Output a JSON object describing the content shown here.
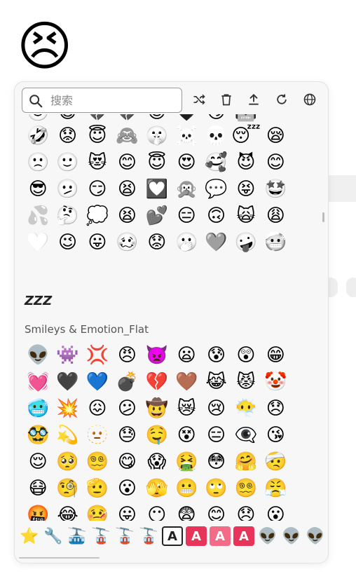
{
  "hero_emoji": "😣",
  "search": {
    "placeholder": "搜索"
  },
  "toolbar": {
    "icons": [
      "shuffle-icon",
      "trash-icon",
      "upload-icon",
      "refresh-icon",
      "globe-icon"
    ]
  },
  "outline_top_partial": [
    "🙂",
    "😺",
    "💔",
    "💔",
    "😊",
    "🖤",
    "😏",
    "🤖",
    ""
  ],
  "outline_rows": [
    [
      "🤣",
      "😟",
      "😇",
      "🙈",
      "🤫",
      "☠️",
      "💀",
      "😴",
      "😪"
    ],
    [
      "🙁",
      "🙂",
      "😻",
      "😊",
      "😇",
      "😍",
      "🥰",
      "😈",
      "😊"
    ],
    [
      "😎",
      "🫤",
      "😏",
      "😫",
      "💟",
      "🙊",
      "💬",
      "😝",
      "🤩"
    ],
    [
      "💦",
      "🤔",
      "💭",
      "😫",
      "💕",
      "😑",
      "🙃",
      "🙀",
      "😩"
    ],
    [
      "🤍",
      "😉",
      "😛",
      "🥴",
      "😟",
      "🫢",
      "🩶",
      "🤪",
      "🥶"
    ]
  ],
  "zzz_label": "ZZZ",
  "section_title": "Smileys & Emotion_Flat",
  "flat_rows": [
    [
      "👽",
      "👾",
      "💢",
      "😠",
      "👿",
      "😦",
      "😰",
      "😲",
      "😁"
    ],
    [
      "💓",
      "🖤",
      "💙",
      "💣",
      "💔",
      "🤎",
      "😹",
      "😾",
      "🤡"
    ],
    [
      "🥶",
      "💥",
      "😖",
      "😕",
      "🤠",
      "😿",
      "😢",
      "😶‍🌫️",
      "😞"
    ],
    [
      "🥸",
      "💫",
      "🫥",
      "😓",
      "🤤",
      "😵",
      "😑",
      "👁️‍🗨️",
      "😘"
    ],
    [
      "😌",
      "🥺",
      "😵‍💫",
      "😋",
      "😱",
      "🤮",
      "😳",
      "🤗",
      "🤕"
    ],
    [
      "😷",
      "🧐",
      "🫡",
      "😮",
      "🫣",
      "😬",
      "🙄",
      "😵‍💫",
      "😤"
    ],
    [
      "🤬",
      "😂",
      "🤒",
      "😛",
      "😶",
      "😨",
      "😊",
      "😞",
      "😮"
    ],
    [
      "👻",
      "👹",
      "💚",
      "😐",
      "😸",
      "😼",
      "😄",
      "🤩",
      "😀"
    ]
  ],
  "category_bar": [
    "⭐",
    "🔧",
    "🚠",
    "🚡",
    "🚡",
    "🚡",
    "A",
    "A",
    "A",
    "A",
    "👽",
    "👽",
    "👽"
  ]
}
